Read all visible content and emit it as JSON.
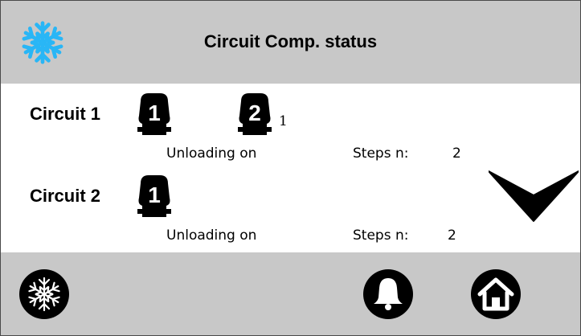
{
  "header": {
    "title": "Circuit Comp. status",
    "icon": "snowflake-icon",
    "icon_color": "#29b6f6"
  },
  "circuits": [
    {
      "label": "Circuit 1",
      "compressors": [
        {
          "number": "1",
          "suffix": ""
        },
        {
          "number": "2",
          "suffix": "1"
        }
      ],
      "unloading": "Unloading on",
      "steps_label": "Steps n:",
      "steps_value": "2"
    },
    {
      "label": "Circuit 2",
      "compressors": [
        {
          "number": "1",
          "suffix": ""
        }
      ],
      "unloading": "Unloading on",
      "steps_label": "Steps n:",
      "steps_value": "2"
    }
  ],
  "scroll_down_icon": "chevron-down-icon",
  "footer": {
    "buttons": [
      "snowflake-icon",
      "bell-icon",
      "home-icon"
    ]
  },
  "colors": {
    "bar_gray": "#c8c8c8",
    "accent_blue": "#29b6f6"
  }
}
